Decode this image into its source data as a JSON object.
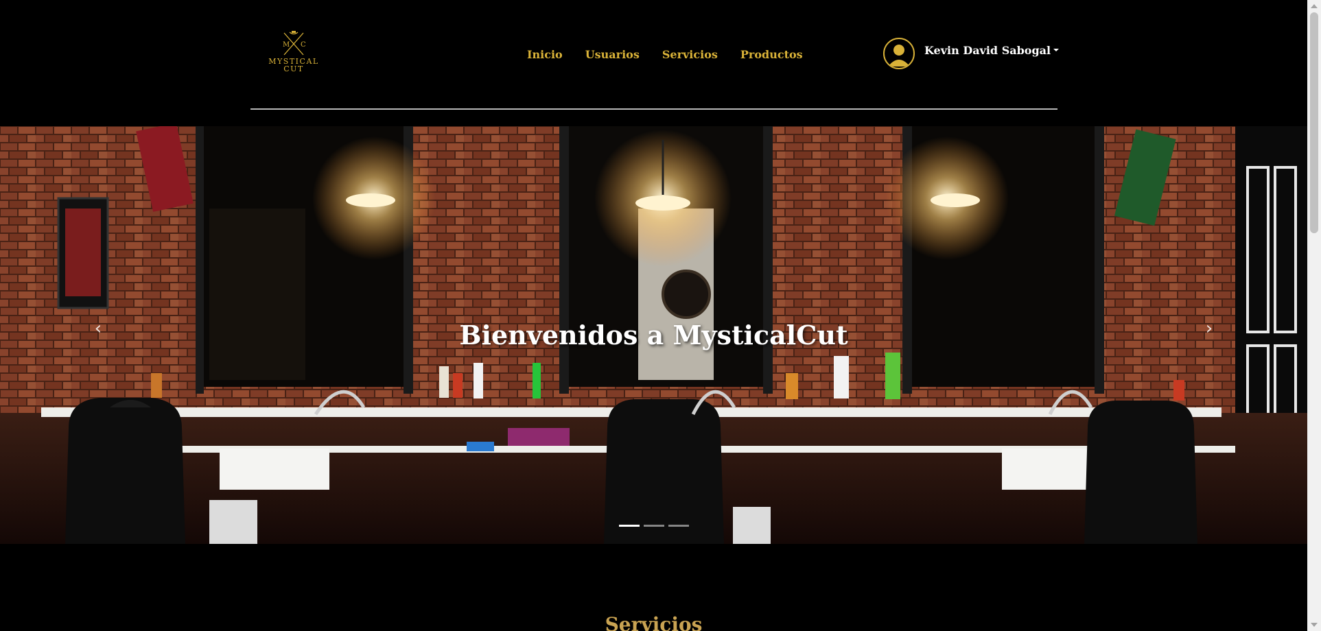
{
  "brand": {
    "logo_initial_left": "M",
    "logo_initial_right": "C",
    "logo_line1": "MYSTICAL",
    "logo_line2": "CUT"
  },
  "nav": {
    "items": [
      {
        "label": "Inicio"
      },
      {
        "label": "Usuarios"
      },
      {
        "label": "Servicios"
      },
      {
        "label": "Productos"
      }
    ]
  },
  "user": {
    "name": "Kevin David Sabogal"
  },
  "hero": {
    "title": "Bienvenidos a MysticalCut",
    "slide_count": 3,
    "active_slide": 1
  },
  "sections": {
    "services_title": "Servicios"
  },
  "colors": {
    "accent": "#d9b238",
    "background": "#000000",
    "section_title": "#c9a352"
  },
  "icons": {
    "prev": "chevron-left-icon",
    "next": "chevron-right-icon",
    "avatar": "user-avatar-icon"
  }
}
